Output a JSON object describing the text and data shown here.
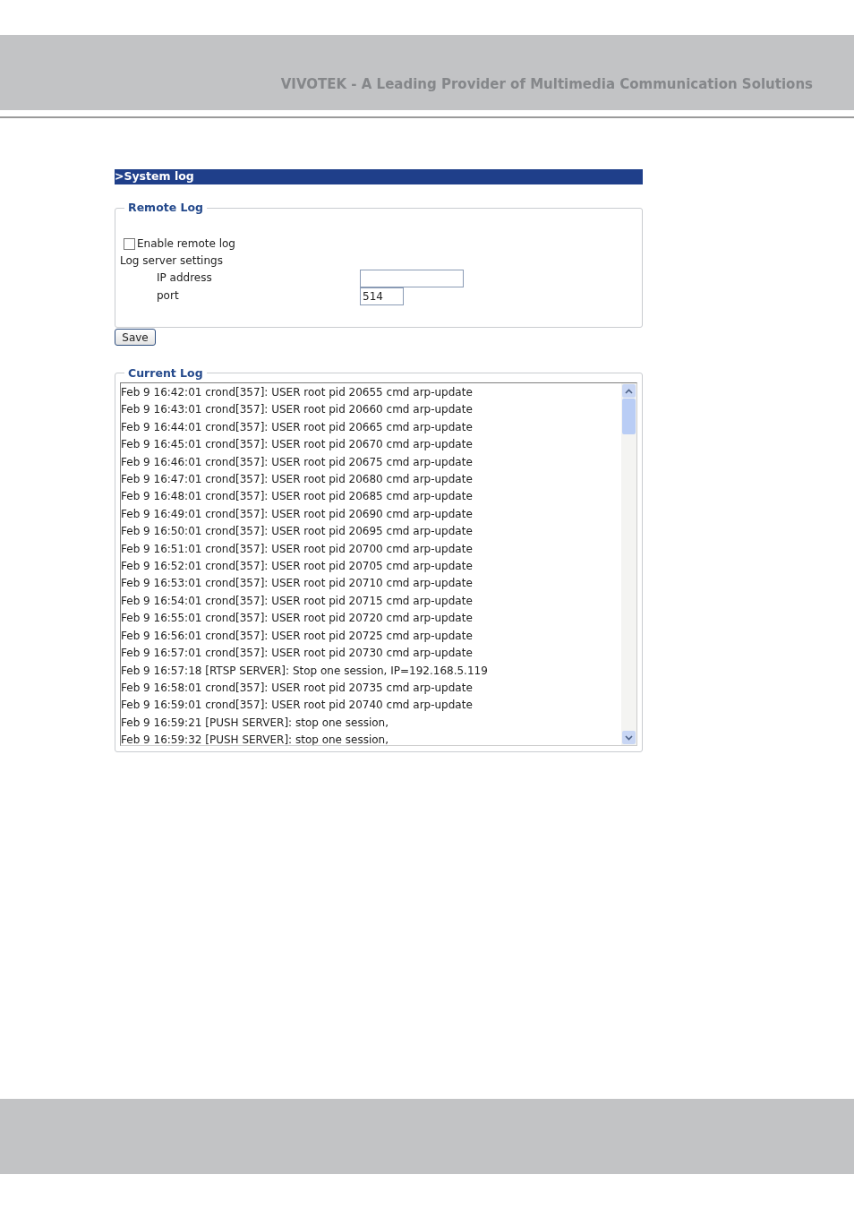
{
  "page_header": {
    "tagline": "VIVOTEK - A Leading Provider of Multimedia Communication Solutions"
  },
  "title": ">System log",
  "remote_log": {
    "legend": "Remote Log",
    "enable": {
      "label": "Enable remote log",
      "checked": false
    },
    "settings_label": "Log server settings",
    "fields": [
      {
        "label": "IP address",
        "wide": true
      },
      {
        "label": "port",
        "value": "514",
        "wide": false
      }
    ]
  },
  "save_button": "Save",
  "current_log": {
    "legend": "Current Log",
    "lines": [
      "Feb 9 16:42:01 crond[357]: USER root pid 20655 cmd arp-update",
      "Feb 9 16:43:01 crond[357]: USER root pid 20660 cmd arp-update",
      "Feb 9 16:44:01 crond[357]: USER root pid 20665 cmd arp-update",
      "Feb 9 16:45:01 crond[357]: USER root pid 20670 cmd arp-update",
      "Feb 9 16:46:01 crond[357]: USER root pid 20675 cmd arp-update",
      "Feb 9 16:47:01 crond[357]: USER root pid 20680 cmd arp-update",
      "Feb 9 16:48:01 crond[357]: USER root pid 20685 cmd arp-update",
      "Feb 9 16:49:01 crond[357]: USER root pid 20690 cmd arp-update",
      "Feb 9 16:50:01 crond[357]: USER root pid 20695 cmd arp-update",
      "Feb 9 16:51:01 crond[357]: USER root pid 20700 cmd arp-update",
      "Feb 9 16:52:01 crond[357]: USER root pid 20705 cmd arp-update",
      "Feb 9 16:53:01 crond[357]: USER root pid 20710 cmd arp-update",
      "Feb 9 16:54:01 crond[357]: USER root pid 20715 cmd arp-update",
      "Feb 9 16:55:01 crond[357]: USER root pid 20720 cmd arp-update",
      "Feb 9 16:56:01 crond[357]: USER root pid 20725 cmd arp-update",
      "Feb 9 16:57:01 crond[357]: USER root pid 20730 cmd arp-update",
      "Feb 9 16:57:18 [RTSP SERVER]: Stop one session, IP=192.168.5.119",
      "Feb 9 16:58:01 crond[357]: USER root pid 20735 cmd arp-update",
      "Feb 9 16:59:01 crond[357]: USER root pid 20740 cmd arp-update",
      "Feb 9 16:59:21 [PUSH SERVER]: stop one session,",
      "Feb 9 16:59:32 [PUSH SERVER]: stop one session,"
    ]
  }
}
